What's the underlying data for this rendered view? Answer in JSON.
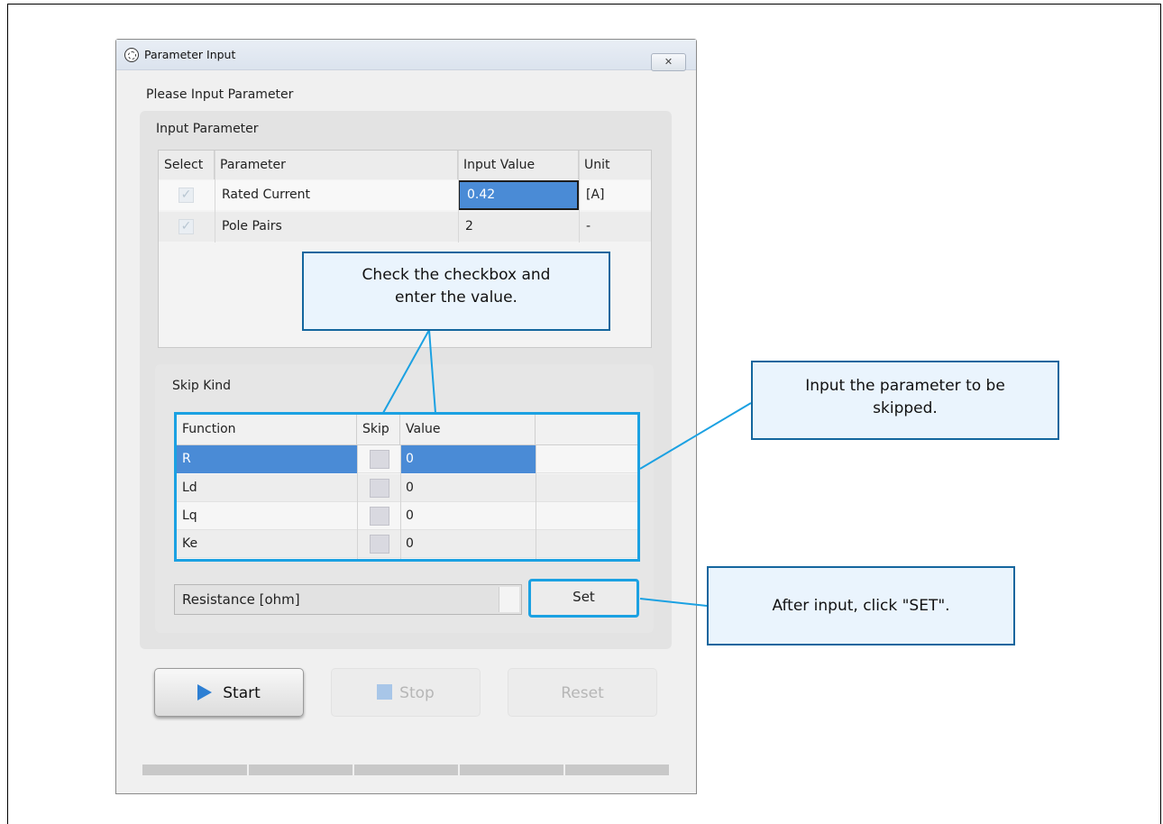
{
  "window": {
    "title": "Parameter Input",
    "close_glyph": "✕",
    "heading": "Please Input Parameter"
  },
  "input_parameter": {
    "group_label": "Input Parameter",
    "columns": [
      "Select",
      "Parameter",
      "Input Value",
      "Unit"
    ],
    "rows": [
      {
        "checked": true,
        "parameter": "Rated Current",
        "value": "0.42",
        "unit": "[A]"
      },
      {
        "checked": true,
        "parameter": "Pole Pairs",
        "value": "2",
        "unit": "-"
      }
    ]
  },
  "skip_kind": {
    "group_label": "Skip Kind",
    "columns": [
      "Function",
      "Skip",
      "Value",
      ""
    ],
    "rows": [
      {
        "function": "R",
        "skip": false,
        "value": "0"
      },
      {
        "function": "Ld",
        "skip": false,
        "value": "0"
      },
      {
        "function": "Lq",
        "skip": false,
        "value": "0"
      },
      {
        "function": "Ke",
        "skip": false,
        "value": "0"
      }
    ],
    "selected_row": 0,
    "combo_value": "Resistance [ohm]",
    "set_label": "Set"
  },
  "actions": {
    "start_label": "Start",
    "stop_label": "Stop",
    "reset_label": "Reset"
  },
  "callouts": {
    "checkbox_note_line1": "Check the checkbox and",
    "checkbox_note_line2": "enter the value.",
    "skip_note_line1": "Input the parameter to be",
    "skip_note_line2": "skipped.",
    "set_note": "After input, click \"SET\"."
  },
  "colors": {
    "highlight": "#1ba1e2",
    "selection": "#4a8bd6",
    "callout_fill": "#eaf4fd",
    "callout_border": "#14669e"
  }
}
